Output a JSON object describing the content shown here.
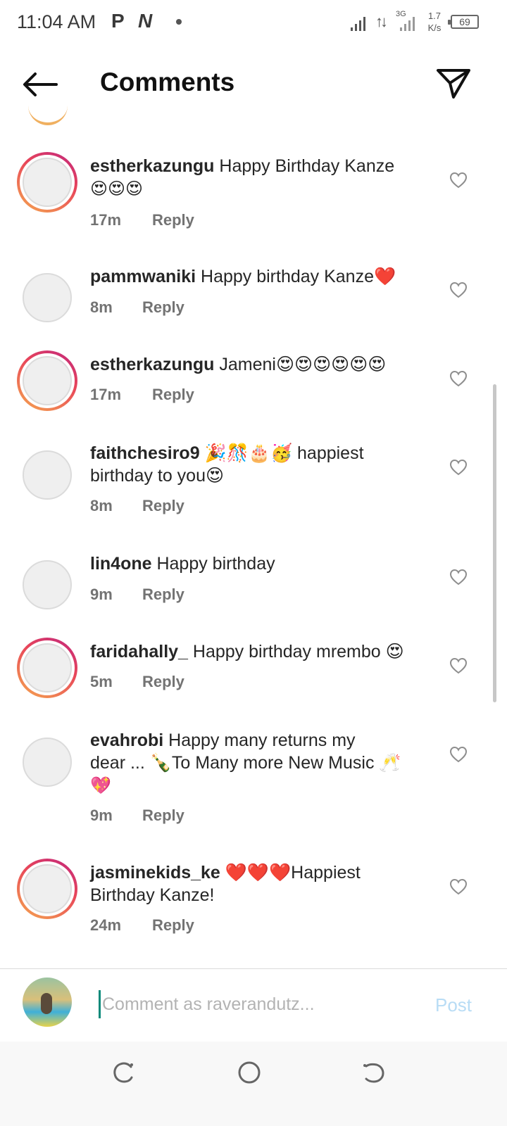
{
  "status_bar": {
    "time": "11:04 AM",
    "icon_p": "P",
    "icon_n": "N",
    "network_type": "3G",
    "speed_value": "1.7",
    "speed_unit": "K/s",
    "battery": "69"
  },
  "header": {
    "title": "Comments",
    "back_icon": "arrow-left-icon",
    "send_icon": "paper-plane-icon"
  },
  "comments": [
    {
      "username": "estherkazungu",
      "text": " Happy Birthday Kanze",
      "text_line2": "😍😍😍",
      "time": "17m",
      "reply": "Reply",
      "has_story_ring": true
    },
    {
      "username": "pammwaniki",
      "text": " Happy birthday Kanze❤️",
      "time": "8m",
      "reply": "Reply",
      "has_story_ring": false
    },
    {
      "username": "estherkazungu",
      "text": " Jameni😍😍😍😍😍😍",
      "time": "17m",
      "reply": "Reply",
      "has_story_ring": true
    },
    {
      "username": "faithchesiro9",
      "text": " 🎉🎊🎂🥳 happiest",
      "text_line2": "birthday to you😍",
      "time": "8m",
      "reply": "Reply",
      "has_story_ring": false
    },
    {
      "username": "lin4one",
      "text": " Happy birthday",
      "time": "9m",
      "reply": "Reply",
      "has_story_ring": false
    },
    {
      "username": "faridahally_",
      "text": " Happy birthday mrembo 😍",
      "time": "5m",
      "reply": "Reply",
      "has_story_ring": true
    },
    {
      "username": "evahrobi",
      "text": " Happy many returns my",
      "text_line2": "dear ... 🍾To Many more New Music 🥂",
      "text_line3": "💖",
      "time": "9m",
      "reply": "Reply",
      "has_story_ring": false
    },
    {
      "username": "jasminekids_ke",
      "text": " ❤️❤️❤️Happiest",
      "text_line2": "Birthday Kanze!",
      "time": "24m",
      "reply": "Reply",
      "has_story_ring": true
    }
  ],
  "comment_input": {
    "placeholder": "Comment as raverandutz...",
    "post_label": "Post"
  },
  "nav": {
    "recents_icon": "recents-icon",
    "home_icon": "home-circle-icon",
    "back_icon": "nav-back-icon"
  },
  "colors": {
    "story_ring_start": "#c0267f",
    "story_ring_end": "#f5a84f",
    "post_disabled": "#b8dcf5",
    "heart_red": "#e0245e"
  }
}
